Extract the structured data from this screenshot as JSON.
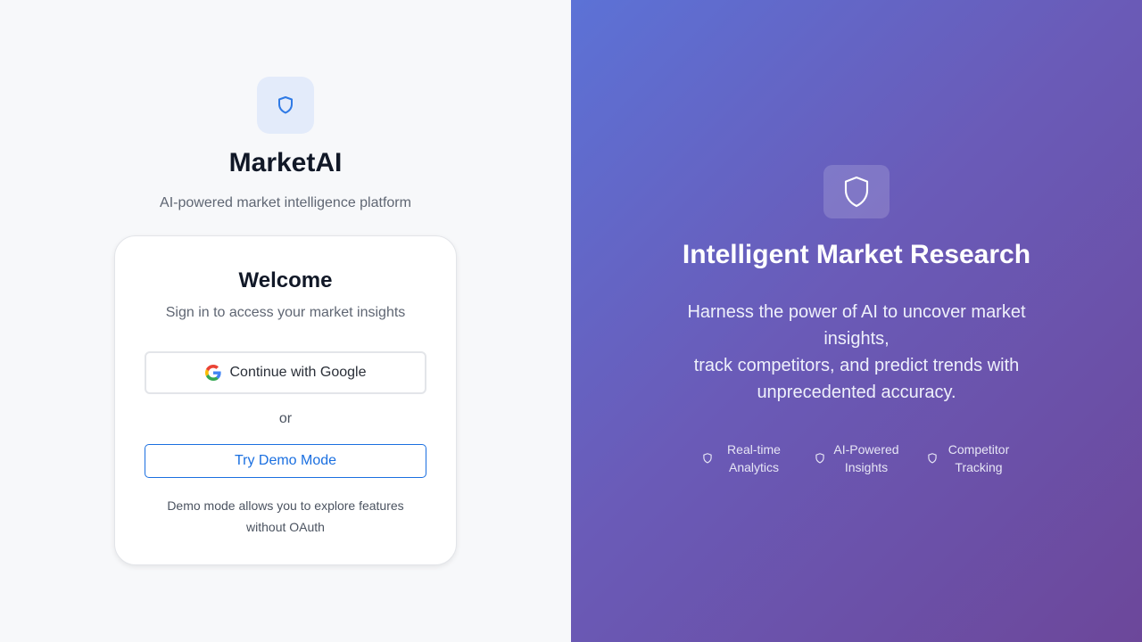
{
  "brand": {
    "name": "MarketAI",
    "tagline": "AI-powered market intelligence platform",
    "icon": "shield-icon"
  },
  "login_card": {
    "title": "Welcome",
    "subtitle": "Sign in to access your market insights",
    "google_button": "Continue with Google",
    "divider": "or",
    "demo_button": "Try Demo Mode",
    "demo_note": "Demo mode allows you to explore features without OAuth"
  },
  "hero": {
    "title": "Intelligent Market Research",
    "description_line1": "Harness the power of AI to uncover market insights,",
    "description_line2": "track competitors, and predict trends with unprecedented accuracy.",
    "features": [
      {
        "label": "Real-time Analytics",
        "icon": "shield-icon"
      },
      {
        "label": "AI-Powered Insights",
        "icon": "shield-icon"
      },
      {
        "label": "Competitor Tracking",
        "icon": "shield-icon"
      }
    ]
  },
  "colors": {
    "accent": "#1a6fe0",
    "gradient_start": "#5c72d6",
    "gradient_end": "#6c479a"
  }
}
